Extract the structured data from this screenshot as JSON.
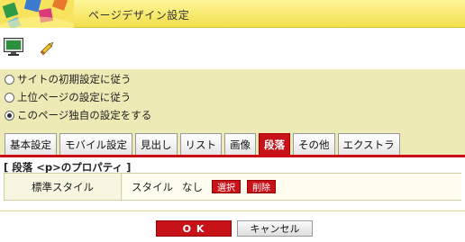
{
  "window": {
    "title": "ページデザイン設定"
  },
  "icons": {
    "screen": "monitor-icon",
    "edit": "pencil-icon",
    "logo": "color-squares-logo"
  },
  "radio_options": [
    {
      "label": "サイトの初期設定に従う",
      "checked": false
    },
    {
      "label": "上位ページの設定に従う",
      "checked": false
    },
    {
      "label": "このページ独自の設定をする",
      "checked": true
    }
  ],
  "tabs": [
    {
      "label": "基本設定",
      "active": false
    },
    {
      "label": "モバイル設定",
      "active": false
    },
    {
      "label": "見出し",
      "active": false
    },
    {
      "label": "リスト",
      "active": false
    },
    {
      "label": "画像",
      "active": false
    },
    {
      "label": "段落",
      "active": true
    },
    {
      "label": "その他",
      "active": false
    },
    {
      "label": "エクストラ",
      "active": false
    }
  ],
  "section": {
    "title": "[ 段落 <p>のプロパティ ]",
    "row_label": "標準スタイル",
    "value_label": "スタイル",
    "value": "なし",
    "select_button": "選択",
    "delete_button": "削除"
  },
  "footer": {
    "ok": "O K",
    "cancel": "キャンセル"
  },
  "colors": {
    "accent": "#c8121a",
    "panel": "#eeeab5",
    "titlebar": "#f2de4c"
  }
}
